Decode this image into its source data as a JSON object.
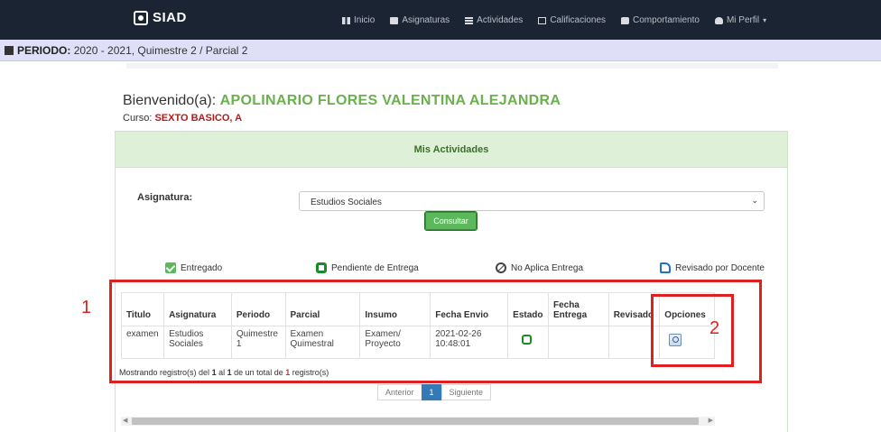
{
  "navbar": {
    "brand": "SIAD",
    "items": [
      {
        "label": "Inicio",
        "icon": "grid-icon"
      },
      {
        "label": "Asignaturas",
        "icon": "book-icon"
      },
      {
        "label": "Actividades",
        "icon": "list-icon"
      },
      {
        "label": "Calificaciones",
        "icon": "calendar-icon"
      },
      {
        "label": "Comportamiento",
        "icon": "chat-icon"
      },
      {
        "label": "Mi Perfil",
        "icon": "user-icon"
      }
    ]
  },
  "period": {
    "label": "PERIODO:",
    "value": "2020 - 2021, Quimestre 2 / Parcial 2"
  },
  "welcome": {
    "prefix": "Bienvenido(a):",
    "name": "APOLINARIO FLORES VALENTINA ALEJANDRA"
  },
  "curso": {
    "label": "Curso:",
    "value": "SEXTO BASICO, A"
  },
  "panel": {
    "title": "Mis Actividades",
    "asignatura_label": "Asignatura:",
    "asignatura_value": "Estudios Sociales",
    "consultar_label": "Consultar",
    "legend": [
      "Entregado",
      "Pendiente de Entrega",
      "No Aplica Entrega",
      "Revisado por Docente"
    ],
    "columns": [
      "Titulo",
      "Asignatura",
      "Periodo",
      "Parcial",
      "Insumo",
      "Fecha Envio",
      "Estado",
      "Fecha Entrega",
      "Revisado",
      "Opciones"
    ],
    "rows": [
      {
        "titulo": "examen",
        "asignatura": "Estudios Sociales",
        "periodo": "Quimestre 1",
        "parcial": "Examen Quimestral",
        "insumo": "Examen/ Proyecto",
        "fecha_envio": "2021-02-26 10:48:01",
        "fecha_entrega": "",
        "revisado": ""
      }
    ],
    "summary": {
      "pre": "Mostrando registro(s) del",
      "from": "1",
      "mid1": "al",
      "to": "1",
      "mid2": "de un total de",
      "total": "1",
      "post": "registro(s)"
    },
    "pager": {
      "prev": "Anterior",
      "page": "1",
      "next": "Siguiente"
    }
  },
  "annotations": {
    "one": "1",
    "two": "2"
  },
  "colors": {
    "navbar": "#1b2432",
    "period_bar": "#dfe0f7",
    "accent_green": "#6ab04c",
    "curso_red": "#b51b16",
    "annotation_red": "#e02020"
  }
}
